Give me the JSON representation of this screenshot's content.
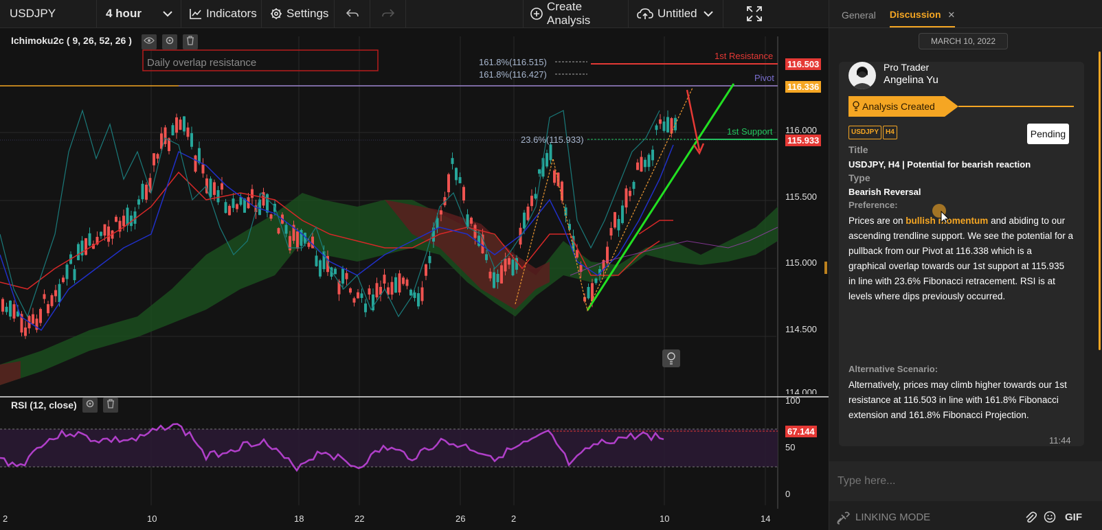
{
  "toolbar": {
    "symbol": "USDJPY",
    "timeframe": "4 hour",
    "indicators": "Indicators",
    "settings": "Settings",
    "create_analysis": "Create Analysis",
    "layout_name": "Untitled"
  },
  "studies": {
    "ichimoku": "Ichimoku2c ( 9, 26, 52, 26 )",
    "rsi": "RSI (12, close)"
  },
  "price_axis": [
    "116.000",
    "115.500",
    "115.000",
    "114.500",
    "114.000"
  ],
  "rsi_axis": [
    "100",
    "50",
    "0"
  ],
  "time_axis": [
    "2",
    "10",
    "18",
    "22",
    "26",
    "2",
    "10",
    "14"
  ],
  "price_tags": {
    "resistance": "116.503",
    "pivot": "116.336",
    "support_axis": "115.933",
    "rsi": "67.144"
  },
  "annotations": {
    "daily_overlap": "Daily overlap resistance",
    "fib_161_a": "161.8%(116.515)",
    "fib_161_b": "161.8%(116.427)",
    "fib_23": "23.6%(115.933)",
    "first_resistance": "1st Resistance",
    "pivot": "Pivot",
    "first_support": "1st Support"
  },
  "colors": {
    "accent": "#f5a623",
    "resistance": "#e53935",
    "pivot": "#7b6fd0",
    "support": "#22c55e",
    "rsi_line": "#b03fc9"
  },
  "panel": {
    "tabs": [
      "General",
      "Discussion"
    ],
    "active_tab": "Discussion",
    "date": "MARCH 10, 2022",
    "author_role": "Pro Trader",
    "author_name": "Angelina Yu",
    "banner": "Analysis Created",
    "tags": [
      "USDJPY",
      "H4"
    ],
    "status": "Pending",
    "title_label": "Title",
    "title_value": "USDJPY, H4 | Potential for bearish reaction",
    "type_label": "Type",
    "type_value": "Bearish Reversal",
    "preference_label": "Preference:",
    "pref_pre": "Prices are on ",
    "pref_highlight": "bullish momentum",
    "pref_line1_post": " and abiding to our",
    "pref_lines": [
      "ascending trendline support. We see the potential for a",
      "pullback from our Pivot at 116.338 which is a",
      "graphical overlap towards our 1st support at 115.935",
      "in line with 23.6% Fibonacci retracement. RSI is at",
      "levels where dips previously occurred."
    ],
    "alt_label": "Alternative Scenario:",
    "alt_lines": [
      "Alternatively, prices may climb higher towards our 1st",
      "resistance at 116.503 in line with 161.8% Fibonacci",
      "extension and 161.8% Fibonacci Projection."
    ],
    "time": "11:44",
    "input_placeholder": "Type here...",
    "linking_mode": "LINKING MODE",
    "gif": "GIF"
  }
}
